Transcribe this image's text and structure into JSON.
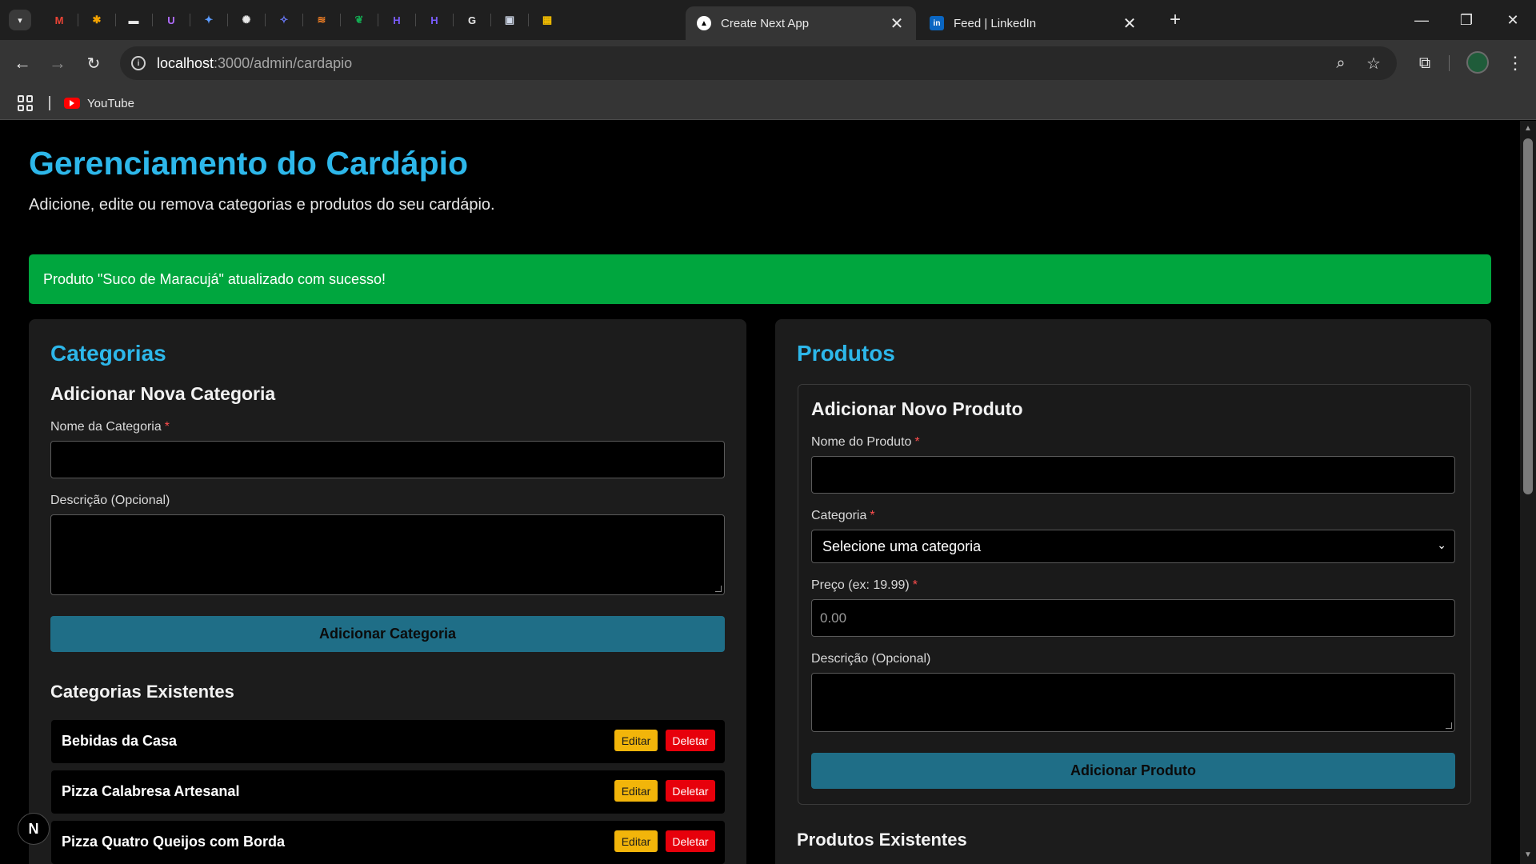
{
  "browser": {
    "pinned_tabs": [
      {
        "icon": "gmail-icon",
        "glyph": "M",
        "color": "#ea4335"
      },
      {
        "icon": "puzzle-app-icon",
        "glyph": "✱",
        "color": "#f4a300"
      },
      {
        "icon": "bus-icon",
        "glyph": "▬",
        "color": "#e8e8e8"
      },
      {
        "icon": "proton-icon",
        "glyph": "U",
        "color": "#b06cff"
      },
      {
        "icon": "gemini-icon",
        "glyph": "✦",
        "color": "#5b9cff"
      },
      {
        "icon": "openai-icon",
        "glyph": "✺",
        "color": "#e8e8e8"
      },
      {
        "icon": "copilot-icon",
        "glyph": "✧",
        "color": "#6b7bff"
      },
      {
        "icon": "stack-icon",
        "glyph": "≋",
        "color": "#f48024"
      },
      {
        "icon": "mongodb-icon",
        "glyph": "❦",
        "color": "#13aa52"
      },
      {
        "icon": "hostinger-icon",
        "glyph": "H",
        "color": "#7a5cff"
      },
      {
        "icon": "hostinger-icon-2",
        "glyph": "H",
        "color": "#7a5cff"
      },
      {
        "icon": "google-icon",
        "glyph": "G",
        "color": "#e8e8e8"
      },
      {
        "icon": "docs-app-icon",
        "glyph": "▣",
        "color": "#cfd8e8"
      },
      {
        "icon": "sheets-app-icon",
        "glyph": "▦",
        "color": "#f6c000"
      }
    ],
    "tabs": [
      {
        "title": "Create Next App",
        "active": true
      },
      {
        "title": "Feed | LinkedIn",
        "active": false
      }
    ],
    "url_host": "localhost",
    "url_path": ":3000/admin/cardapio",
    "bookmarks": [
      {
        "label": "YouTube"
      }
    ]
  },
  "page": {
    "title": "Gerenciamento do Cardápio",
    "subtitle": "Adicione, edite ou remova categorias e produtos do seu cardápio.",
    "alert": "Produto \"Suco de Maracujá\" atualizado com sucesso!"
  },
  "categories": {
    "title": "Categorias",
    "form_title": "Adicionar Nova Categoria",
    "name_label": "Nome da Categoria",
    "desc_label": "Descrição (Opcional)",
    "submit": "Adicionar Categoria",
    "existing_title": "Categorias Existentes",
    "edit_label": "Editar",
    "delete_label": "Deletar",
    "items": [
      {
        "name": "Bebidas da Casa"
      },
      {
        "name": "Pizza Calabresa Artesanal"
      },
      {
        "name": "Pizza Quatro Queijos com Borda"
      }
    ]
  },
  "products": {
    "title": "Produtos",
    "form_title": "Adicionar Novo Produto",
    "name_label": "Nome do Produto",
    "category_label": "Categoria",
    "category_selected": "Selecione uma categoria",
    "price_label": "Preço (ex: 19.99)",
    "price_placeholder": "0.00",
    "desc_label": "Descrição (Opcional)",
    "submit": "Adicionar Produto",
    "existing_title": "Produtos Existentes"
  },
  "required_mark": "*",
  "next_badge": "N",
  "colors": {
    "accent": "#2db7ea",
    "success": "#00a63e",
    "primary_button": "#1f6e87",
    "edit_button": "#f2b50a",
    "delete_button": "#e7000b"
  }
}
